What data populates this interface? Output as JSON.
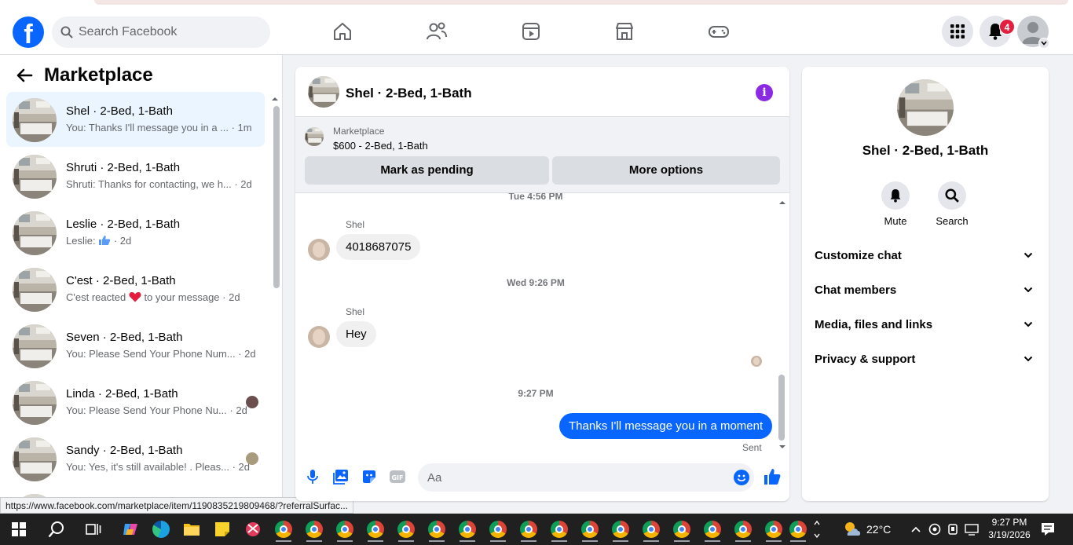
{
  "header": {
    "search_placeholder": "Search Facebook",
    "notifications_count": "4",
    "brand_color": "#0866ff"
  },
  "sidebar": {
    "title": "Marketplace",
    "conversations": [
      {
        "name": "Shel · 2-Bed, 1-Bath",
        "preview": "You: Thanks I'll message you in a ... · 1m",
        "active": true
      },
      {
        "name": "Shruti · 2-Bed, 1-Bath",
        "preview": "Shruti: Thanks for contacting, we h... · 2d"
      },
      {
        "name": "Leslie · 2-Bed, 1-Bath",
        "preview": "Leslie:",
        "preview_suffix": "· 2d",
        "preview_icon": "thumbs-up-icon"
      },
      {
        "name": "C'est · 2-Bed, 1-Bath",
        "preview": "C'est reacted",
        "preview_mid": "to your message",
        "preview_suffix": "· 2d",
        "preview_icon": "heart-icon"
      },
      {
        "name": "Seven · 2-Bed, 1-Bath",
        "preview": "You: Please Send Your Phone Num... · 2d"
      },
      {
        "name": "Linda · 2-Bed, 1-Bath",
        "preview": "You: Please Send Your Phone Nu... · 2d"
      },
      {
        "name": "Sandy · 2-Bed, 1-Bath",
        "preview": "You: Yes, it's still available! . Pleas... · 2d"
      }
    ]
  },
  "status_url": "https://www.facebook.com/marketplace/item/1190835219809468/?referralSurfac...",
  "chat": {
    "title": "Shel · 2-Bed, 1-Bath",
    "marketplace_label": "Marketplace",
    "listing": "$600 - 2-Bed, 1-Bath",
    "mark_pending": "Mark as pending",
    "more_options": "More options",
    "messages": {
      "ts1": "Tue 4:56 PM",
      "sender1": "Shel",
      "msg1": "4018687075",
      "ts2": "Wed 9:26 PM",
      "sender2": "Shel",
      "msg2": "Hey",
      "ts3": "9:27 PM",
      "msg3": "Thanks I'll message you in a moment",
      "status": "Sent"
    },
    "composer_placeholder": "Aa"
  },
  "info": {
    "name": "Shel · 2-Bed, 1-Bath",
    "mute": "Mute",
    "search": "Search",
    "sections": [
      "Customize chat",
      "Chat members",
      "Media, files and links",
      "Privacy & support"
    ]
  },
  "taskbar": {
    "weather": "22°C",
    "time": "9:27 PM",
    "date": "3/19/2026"
  }
}
